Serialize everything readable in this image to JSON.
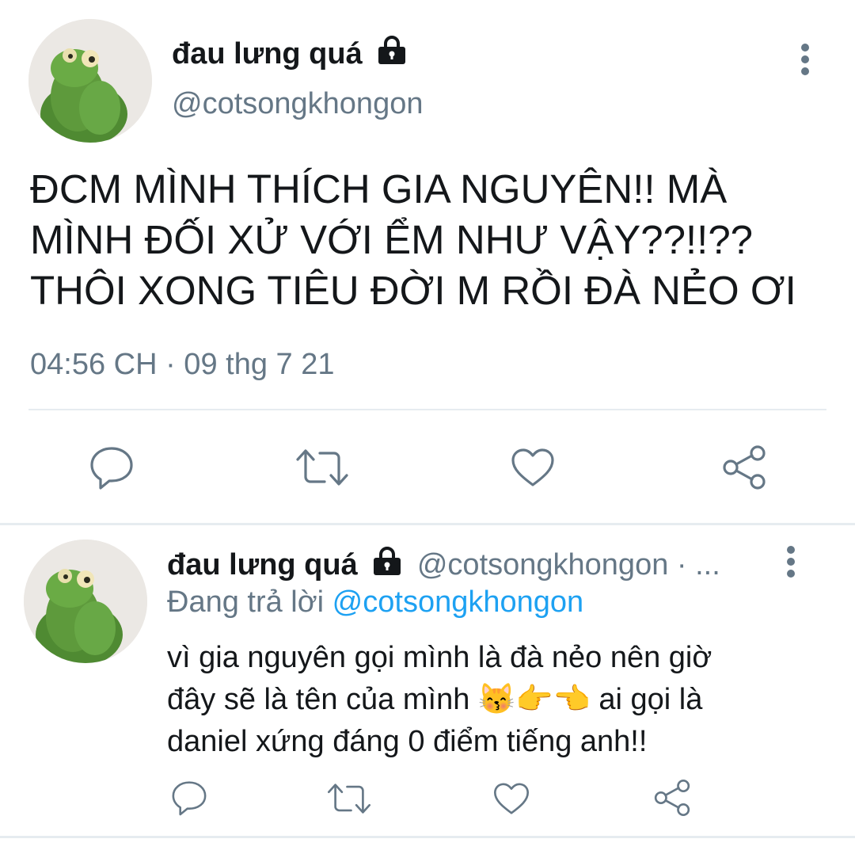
{
  "main_tweet": {
    "display_name": "đau lưng quá",
    "handle": "@cotsongkhongon",
    "text_lines": [
      "ĐCM MÌNH THÍCH GIA NGUYÊN!! MÀ",
      "MÌNH ĐỐI XỬ VỚI ỂM NHƯ VẬY??!!??",
      "THÔI XONG TIÊU ĐỜI M RỒI ĐÀ NẺO ƠI"
    ],
    "timestamp": "04:56 CH · 09 thg 7 21",
    "icons": {
      "lock": "lock-icon",
      "more": "more-vertical-icon",
      "reply": "reply-icon",
      "retweet": "retweet-icon",
      "like": "heart-icon",
      "share": "share-icon"
    }
  },
  "reply_tweet": {
    "display_name": "đau lưng quá",
    "handle_meta": "@cotsongkhongon · ...",
    "replying_label": "Đang trả lời",
    "replying_handle": "@cotsongkhongon",
    "text_lines": [
      "vì gia nguyên gọi mình là đà nẻo nên giờ",
      "đây sẽ là tên của mình 😽👉👈 ai gọi là",
      "daniel xứng đáng 0 điểm tiếng anh!!"
    ]
  },
  "colors": {
    "text": "#14171a",
    "muted": "#657786",
    "link": "#1da1f2",
    "divider": "#e6ecf0",
    "avatar_green": "#5e9a3c"
  }
}
